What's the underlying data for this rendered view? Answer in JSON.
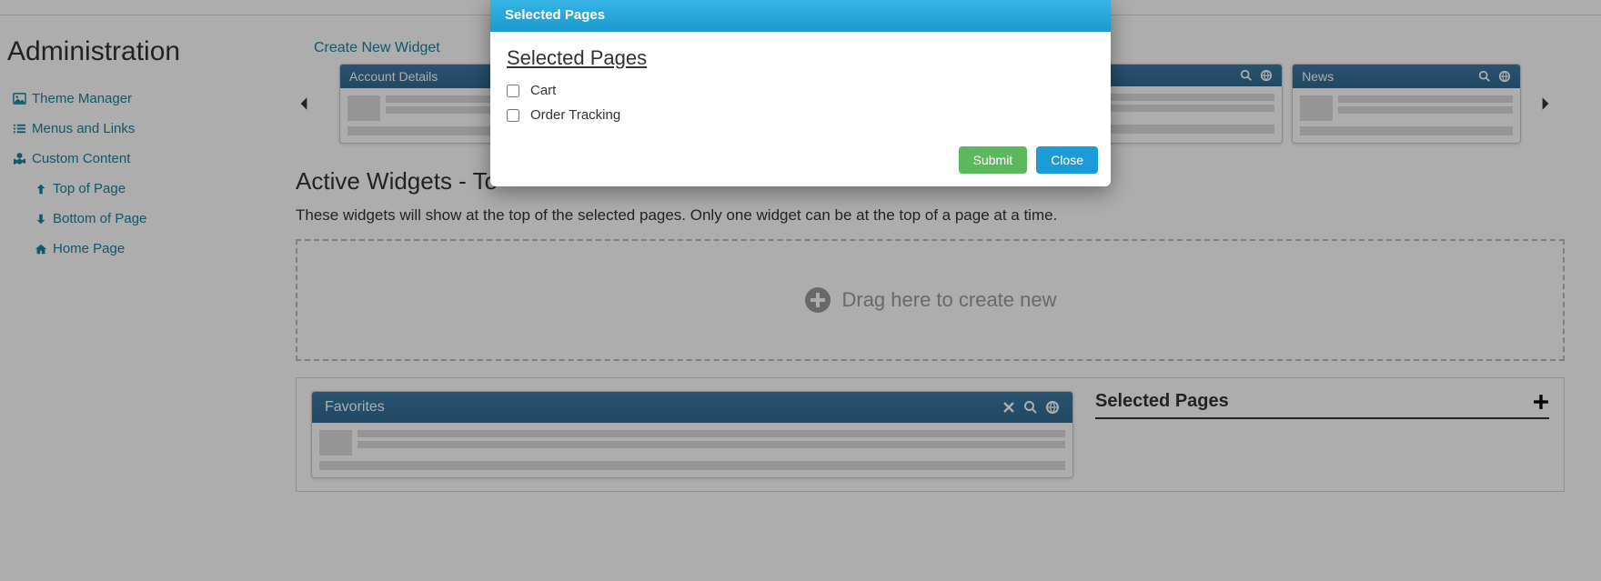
{
  "sidebar": {
    "title": "Administration",
    "items": [
      {
        "label": "Theme Manager"
      },
      {
        "label": "Menus and Links"
      },
      {
        "label": "Custom Content"
      },
      {
        "label": "Top of Page"
      },
      {
        "label": "Bottom of Page"
      },
      {
        "label": "Home Page"
      }
    ]
  },
  "main": {
    "create_link": "Create New Widget",
    "cards": [
      {
        "title": "Account Details"
      },
      {
        "title": ""
      },
      {
        "title": ""
      },
      {
        "title": ""
      },
      {
        "title": "News"
      }
    ],
    "section_title": "Active Widgets - To",
    "section_desc": "These widgets will show at the top of the selected pages. Only one widget can be at the top of a page at a time.",
    "dropzone_text": "Drag here to create new",
    "active_widget": {
      "title": "Favorites"
    },
    "selected_pages_side": {
      "title": "Selected Pages"
    }
  },
  "modal": {
    "header": "Selected Pages",
    "body_title": "Selected Pages",
    "options": [
      {
        "label": "Cart"
      },
      {
        "label": "Order Tracking"
      }
    ],
    "submit": "Submit",
    "close": "Close"
  }
}
